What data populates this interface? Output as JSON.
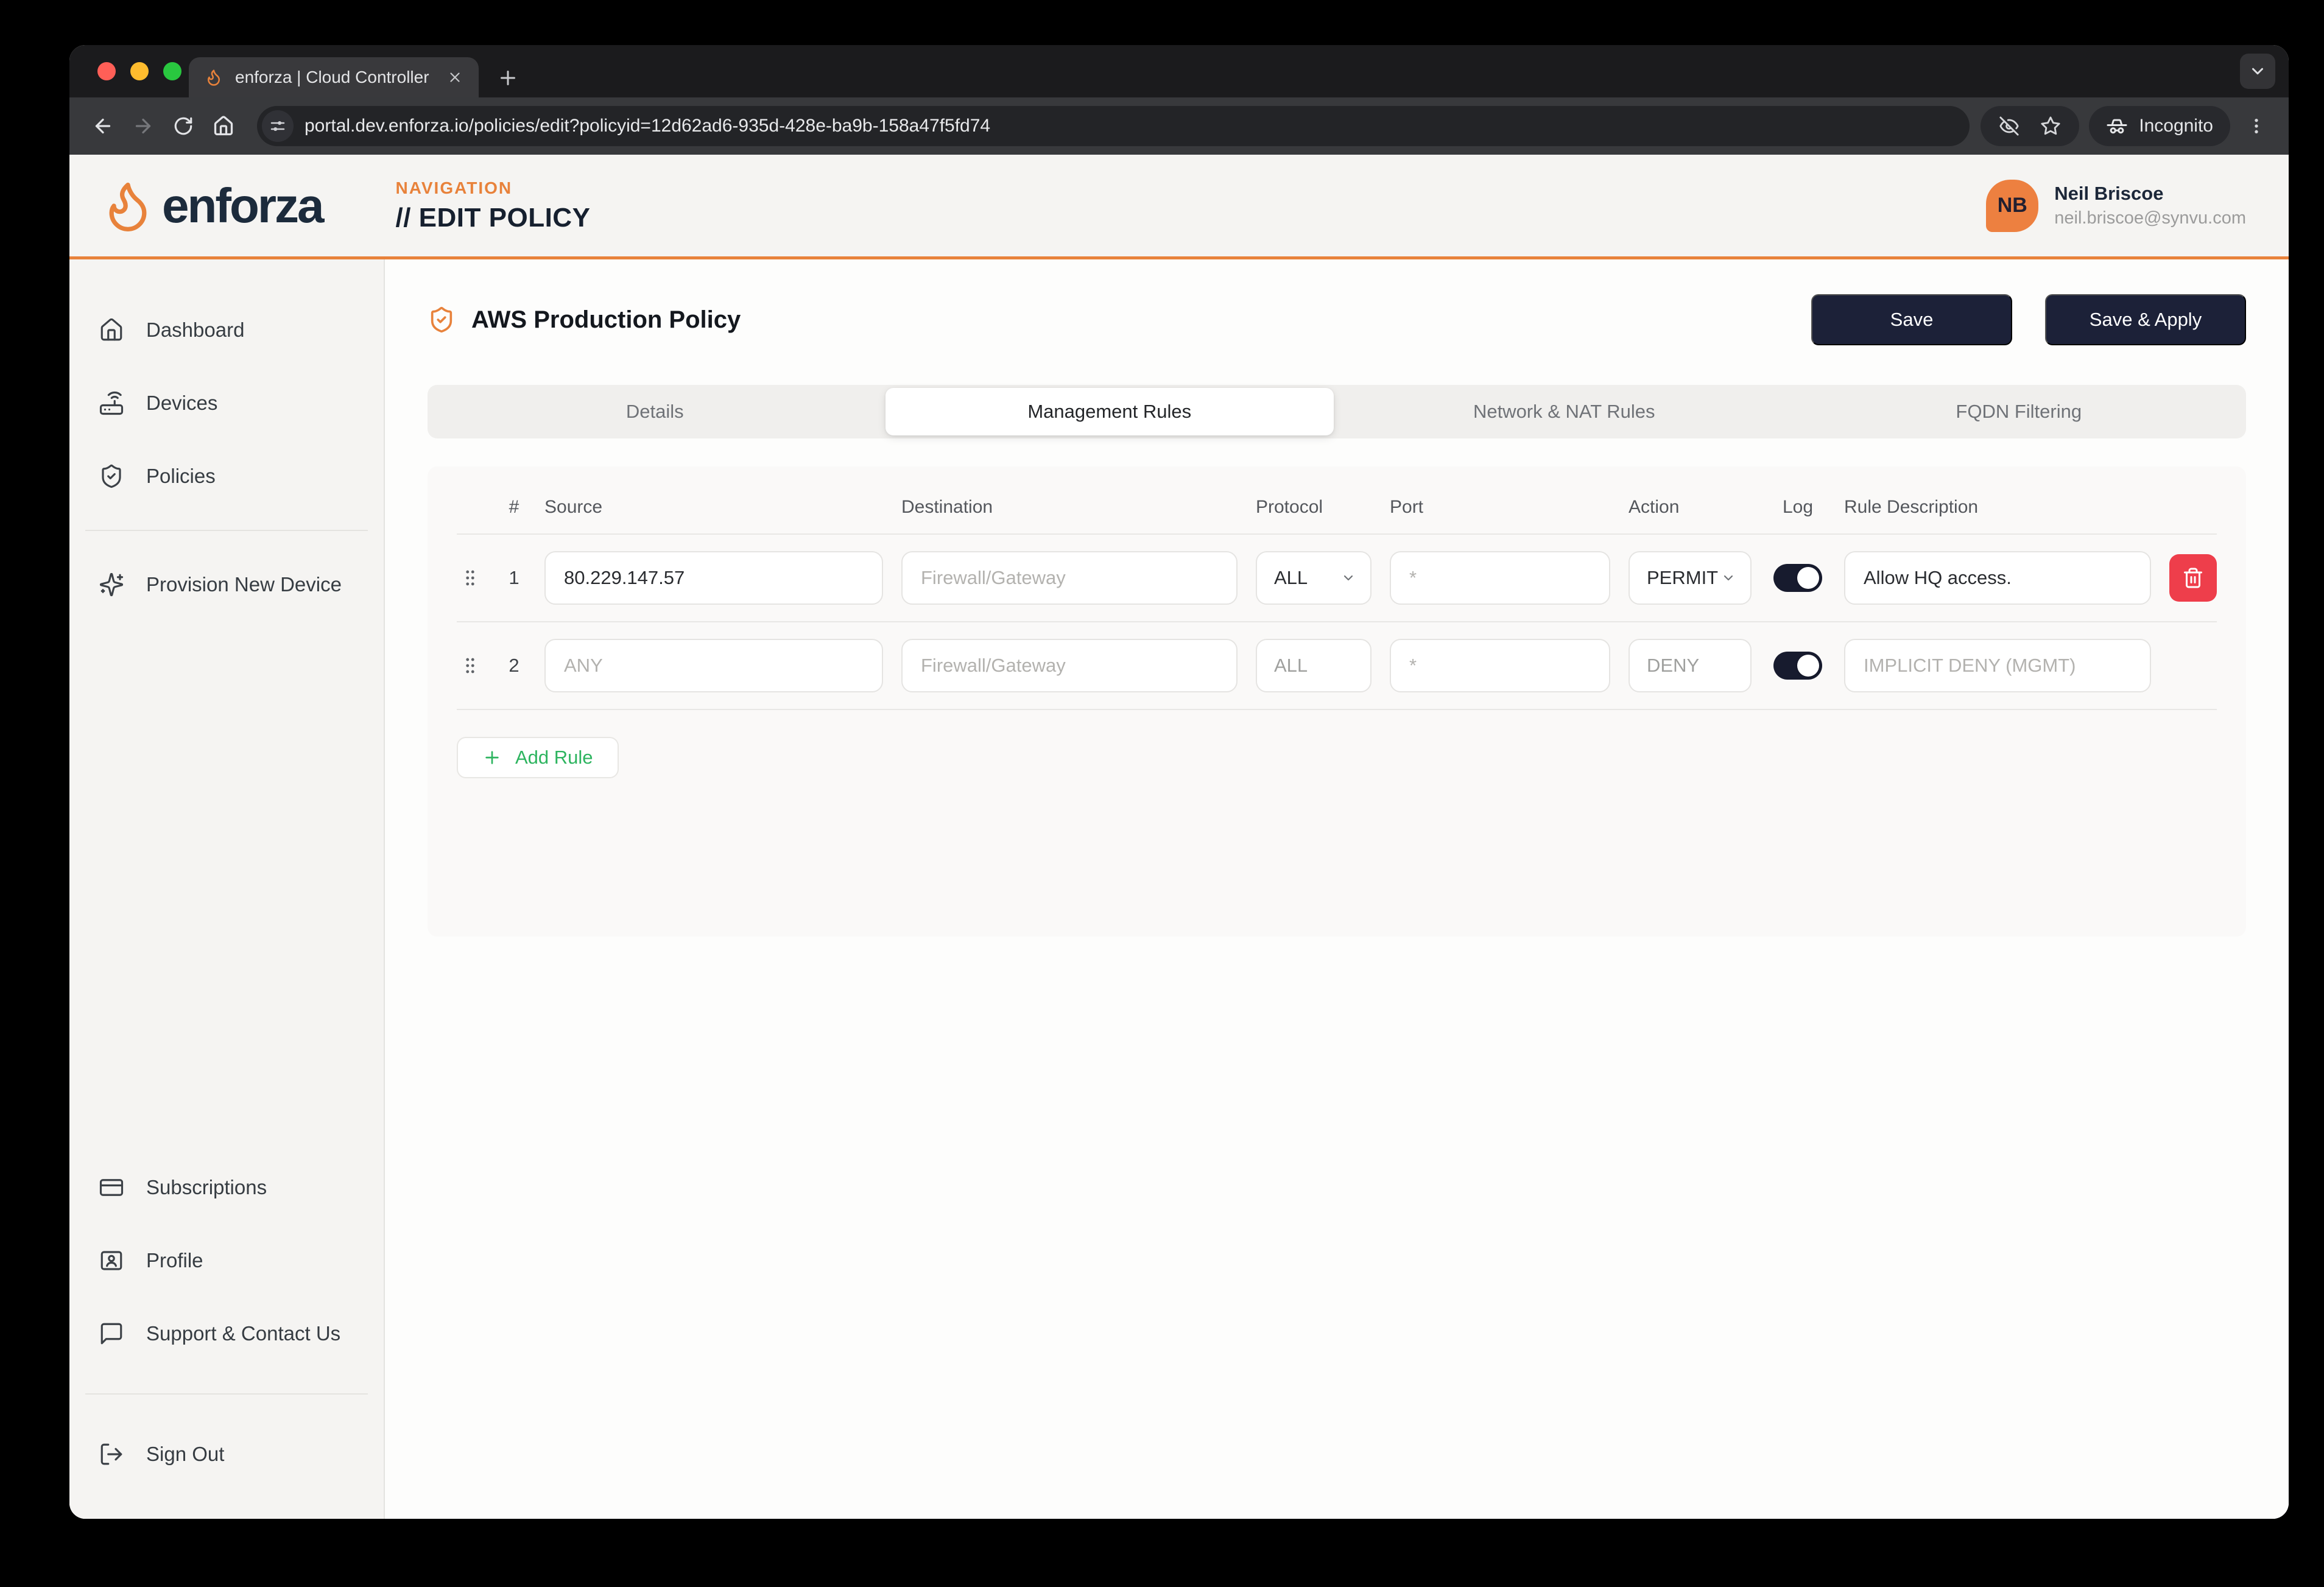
{
  "browser": {
    "tab": {
      "title": "enforza | Cloud Controller"
    },
    "url": "portal.dev.enforza.io/policies/edit?policyid=12d62ad6-935d-428e-ba9b-158a47f5fd74",
    "incognito_label": "Incognito"
  },
  "header": {
    "brand": "enforza",
    "nav_label": "NAVIGATION",
    "page_title": "// EDIT POLICY",
    "user": {
      "initials": "NB",
      "name": "Neil Briscoe",
      "email": "neil.briscoe@synvu.com"
    }
  },
  "sidebar": {
    "items_top": [
      {
        "label": "Dashboard"
      },
      {
        "label": "Devices"
      },
      {
        "label": "Policies"
      }
    ],
    "provision": {
      "label": "Provision New Device"
    },
    "items_bottom": [
      {
        "label": "Subscriptions"
      },
      {
        "label": "Profile"
      },
      {
        "label": "Support & Contact Us"
      }
    ],
    "sign_out": {
      "label": "Sign Out"
    }
  },
  "main": {
    "policy_title": "AWS Production Policy",
    "actions": {
      "save": "Save",
      "save_apply": "Save & Apply"
    },
    "tabs": [
      {
        "label": "Details",
        "active": false
      },
      {
        "label": "Management Rules",
        "active": true
      },
      {
        "label": "Network & NAT Rules",
        "active": false
      },
      {
        "label": "FQDN Filtering",
        "active": false
      }
    ],
    "rules_table": {
      "headers": {
        "num": "#",
        "source": "Source",
        "destination": "Destination",
        "protocol": "Protocol",
        "port": "Port",
        "action": "Action",
        "log": "Log",
        "description": "Rule Description"
      },
      "rows": [
        {
          "num": "1",
          "source_value": "80.229.147.57",
          "destination_placeholder": "Firewall/Gateway",
          "protocol": "ALL",
          "port_placeholder": "*",
          "action": "PERMIT",
          "log_enabled": true,
          "description_value": "Allow HQ access.",
          "locked": false
        },
        {
          "num": "2",
          "source_placeholder": "ANY",
          "destination_placeholder": "Firewall/Gateway",
          "protocol": "ALL",
          "port_placeholder": "*",
          "action": "DENY",
          "log_enabled": true,
          "description_placeholder": "IMPLICIT DENY (MGMT)",
          "locked": true
        }
      ]
    },
    "add_rule_label": "Add Rule"
  },
  "colors": {
    "accent_orange": "#E8823B",
    "navy": "#1C2138",
    "green": "#2DB45F",
    "red": "#EE3E4B"
  }
}
